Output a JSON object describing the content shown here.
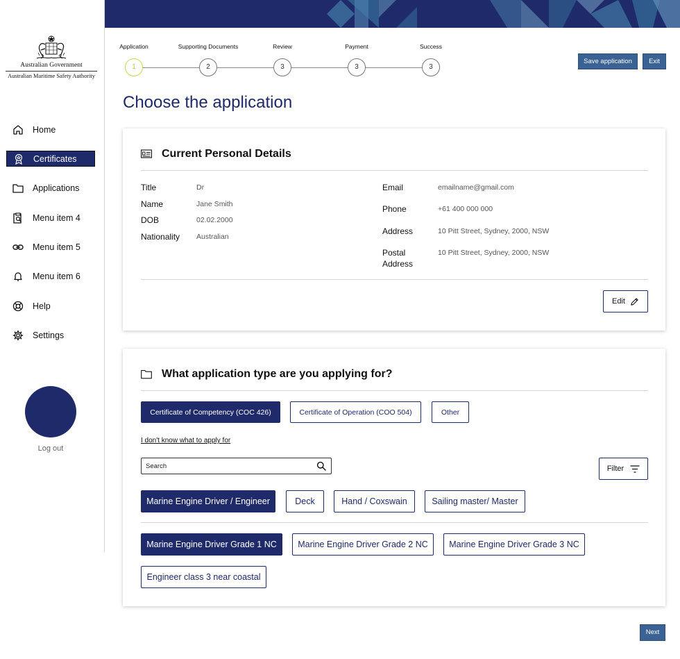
{
  "logo": {
    "line1": "Australian Government",
    "line2": "Australian Maritime Safety Authority"
  },
  "sidebar": {
    "items": [
      {
        "label": "Home",
        "icon": "home-icon"
      },
      {
        "label": "Certificates",
        "icon": "certificate-icon",
        "active": true
      },
      {
        "label": "Applications",
        "icon": "folder-icon"
      },
      {
        "label": "Menu item 4",
        "icon": "clipboard-search-icon"
      },
      {
        "label": "Menu item 5",
        "icon": "link-icon"
      },
      {
        "label": "Menu item 6",
        "icon": "bell-icon"
      },
      {
        "label": "Help",
        "icon": "lifebuoy-icon"
      },
      {
        "label": "Settings",
        "icon": "gear-icon"
      }
    ],
    "logout": "Log out"
  },
  "stepper": {
    "steps": [
      {
        "label": "Application",
        "number": "1",
        "current": true
      },
      {
        "label": "Supporting Documents",
        "number": "2"
      },
      {
        "label": "Review",
        "number": "3"
      },
      {
        "label": "Payment",
        "number": "3"
      },
      {
        "label": "Success",
        "number": "3"
      }
    ]
  },
  "header": {
    "save_label": "Save application",
    "exit_label": "Exit"
  },
  "page_title": "Choose the application",
  "personal": {
    "title": "Current Personal Details",
    "fields_left": [
      {
        "label": "Title",
        "value": "Dr"
      },
      {
        "label": "Name",
        "value": "Jane Smith"
      },
      {
        "label": "DOB",
        "value": "02.02.2000"
      },
      {
        "label": "Nationality",
        "value": "Australian"
      }
    ],
    "email_label": "Email",
    "email_value": "emailname@gmail.com",
    "phone_label": "Phone",
    "phone_value": "+61 400 000 000",
    "address_label": "Address",
    "address_value": "10 Pitt Street, Sydney, 2000, NSW",
    "postal_label_1": "Postal",
    "postal_label_2": "Address",
    "postal_value": "10 Pitt Street, Sydney, 2000, NSW",
    "edit_label": "Edit"
  },
  "application": {
    "title": "What application type are you applying for?",
    "types": [
      {
        "label": "Certificate of Competency (COC 426)",
        "selected": true
      },
      {
        "label": "Certificate of Operation (COO 504)"
      },
      {
        "label": "Other"
      }
    ],
    "help_link": "I don't know what to apply for",
    "search_placeholder": "Search",
    "filter_label": "Filter",
    "categories": [
      {
        "label": "Marine Engine Driver / Engineer",
        "selected": true
      },
      {
        "label": "Deck"
      },
      {
        "label": "Hand / Coxswain"
      },
      {
        "label": "Sailing master/ Master"
      }
    ],
    "grades": [
      {
        "label": "Marine Engine Driver Grade 1 NC",
        "selected": true
      },
      {
        "label": "Marine Engine Driver Grade 2 NC"
      },
      {
        "label": "Marine Engine Driver Grade 3 NC"
      },
      {
        "label": "Engineer class 3 near coastal"
      }
    ]
  },
  "footer": {
    "next_label": "Next"
  },
  "colors": {
    "navy": "#1f2a6a",
    "button_blue": "#3a6294",
    "current_step": "#c9d84a"
  }
}
